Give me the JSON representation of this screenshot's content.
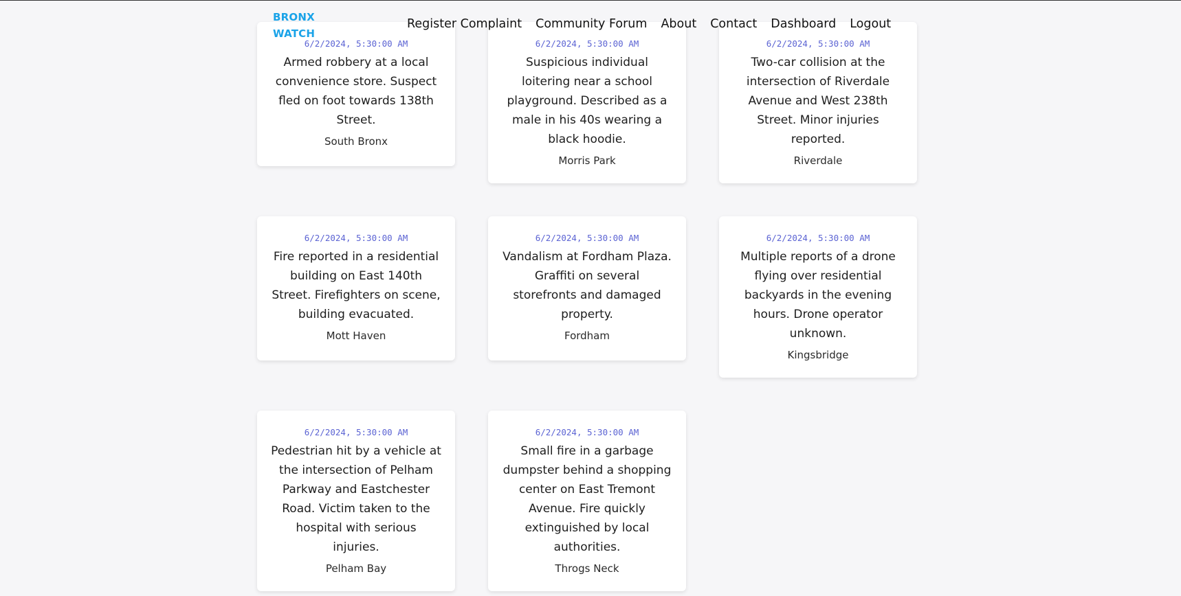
{
  "brand": {
    "line1": "BRONX",
    "line2": "WATCH",
    "color": "#1aa3e8"
  },
  "nav": {
    "items": [
      {
        "label": "Register Complaint"
      },
      {
        "label": "Community Forum"
      },
      {
        "label": "About"
      },
      {
        "label": "Contact"
      },
      {
        "label": "Dashboard"
      },
      {
        "label": "Logout"
      }
    ]
  },
  "reports": [
    {
      "time": "6/2/2024, 5:30:00 AM",
      "description": "Armed robbery at a local convenience store. Suspect fled on foot towards 138th Street.",
      "location": "South Bronx"
    },
    {
      "time": "6/2/2024, 5:30:00 AM",
      "description": "Suspicious individual loitering near a school playground. Described as a male in his 40s wearing a black hoodie.",
      "location": "Morris Park"
    },
    {
      "time": "6/2/2024, 5:30:00 AM",
      "description": "Two-car collision at the intersection of Riverdale Avenue and West 238th Street. Minor injuries reported.",
      "location": "Riverdale"
    },
    {
      "time": "6/2/2024, 5:30:00 AM",
      "description": "Fire reported in a residential building on East 140th Street. Firefighters on scene, building evacuated.",
      "location": "Mott Haven"
    },
    {
      "time": "6/2/2024, 5:30:00 AM",
      "description": "Vandalism at Fordham Plaza. Graffiti on several storefronts and damaged property.",
      "location": "Fordham"
    },
    {
      "time": "6/2/2024, 5:30:00 AM",
      "description": "Multiple reports of a drone flying over residential backyards in the evening hours. Drone operator unknown.",
      "location": "Kingsbridge"
    },
    {
      "time": "6/2/2024, 5:30:00 AM",
      "description": "Pedestrian hit by a vehicle at the intersection of Pelham Parkway and Eastchester Road. Victim taken to the hospital with serious injuries.",
      "location": "Pelham Bay"
    },
    {
      "time": "6/2/2024, 5:30:00 AM",
      "description": "Small fire in a garbage dumpster behind a shopping center on East Tremont Avenue. Fire quickly extinguished by local authorities.",
      "location": "Throgs Neck"
    }
  ]
}
